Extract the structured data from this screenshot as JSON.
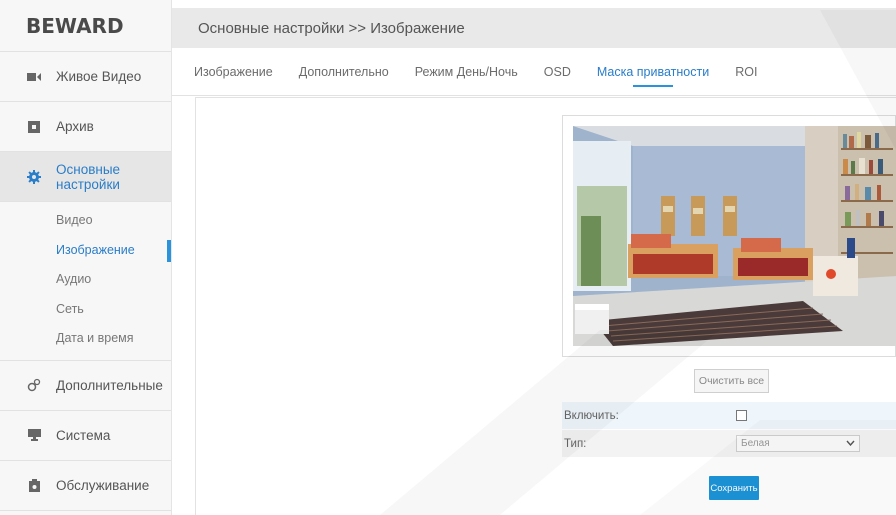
{
  "brand": {
    "logo_text": "BEWARD"
  },
  "sidebar": {
    "items": [
      {
        "label": "Живое Видео",
        "icon": "video-camera-icon"
      },
      {
        "label": "Архив",
        "icon": "archive-icon"
      },
      {
        "label": "Основные настройки",
        "icon": "gear-icon",
        "active": true
      },
      {
        "label": "Дополнительные",
        "icon": "gears-icon"
      },
      {
        "label": "Система",
        "icon": "monitor-icon"
      },
      {
        "label": "Обслуживание",
        "icon": "maintenance-icon"
      }
    ],
    "subitems": [
      {
        "label": "Видео"
      },
      {
        "label": "Изображение",
        "active": true
      },
      {
        "label": "Аудио"
      },
      {
        "label": "Сеть"
      },
      {
        "label": "Дата и время"
      }
    ]
  },
  "header": {
    "breadcrumb": "Основные настройки >> Изображение"
  },
  "tabs": [
    {
      "label": "Изображение"
    },
    {
      "label": "Дополнительно"
    },
    {
      "label": "Режим День/Ночь"
    },
    {
      "label": "OSD"
    },
    {
      "label": "Маска приватности",
      "active": true
    },
    {
      "label": "ROI"
    }
  ],
  "privacy_mask": {
    "clear_all_label": "Очистить все",
    "enable_label": "Включить:",
    "enable_checked": false,
    "type_label": "Тип:",
    "type_value": "Белая",
    "save_label": "Сохранить"
  },
  "colors": {
    "accent": "#2a93dc",
    "sidebar_bg": "#f7f7f7",
    "header_bg": "#e9e9e9",
    "save_button": "#1c94d9"
  }
}
